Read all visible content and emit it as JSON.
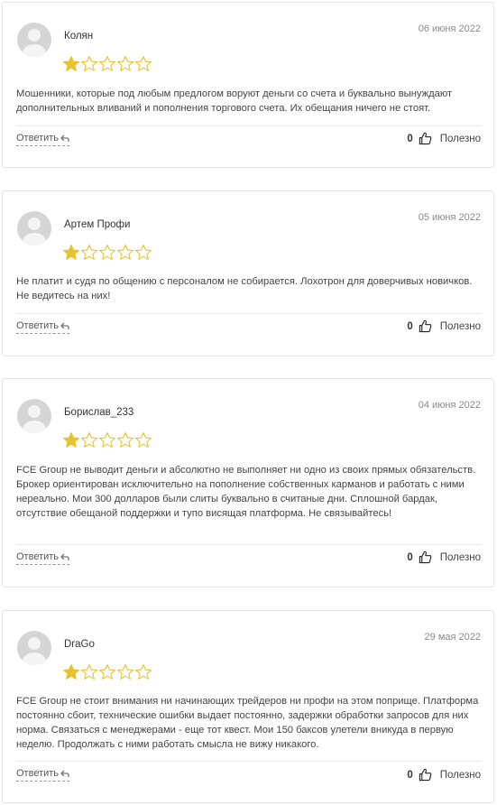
{
  "reviews": [
    {
      "author": "Колян",
      "date": "06 июня 2022",
      "rating": 1,
      "max_rating": 5,
      "text": "Мошенники, которые под любым предлогом воруют деньги со счета и буквально вынуждают дополнительных вливаний и пополнения торгового счета. Их обещания ничего не стоят.",
      "reply_label": "Ответить",
      "likes": "0",
      "useful_label": "Полезно"
    },
    {
      "author": "Артем Профи",
      "date": "05 июня 2022",
      "rating": 1,
      "max_rating": 5,
      "text": "Не платит и судя по общению с персоналом не собирается. Лохотрон для доверчивых новичков. Не ведитесь на них!",
      "reply_label": "Ответить",
      "likes": "0",
      "useful_label": "Полезно"
    },
    {
      "author": "Борислав_233",
      "date": "04 июня 2022",
      "rating": 1,
      "max_rating": 5,
      "text": "FCE Group не выводит деньги и абсолютно не выполняет ни одно из своих прямых обязательств. Брокер ориентирован исключительно на пополнение собственных карманов и работать с ними нереально. Мои 300 долларов были слиты буквально в считаные дни. Сплошной бардак, отсутствие обещаной поддержки и тупо висящая платформа. Не связывайтесь!",
      "reply_label": "Ответить",
      "likes": "0",
      "useful_label": "Полезно"
    },
    {
      "author": "DraGo",
      "date": "29 мая 2022",
      "rating": 1,
      "max_rating": 5,
      "text": "FCE Group не стоит внимания ни начинающих трейдеров ни профи на этом поприще. Платформа постоянно сбоит, технические ошибки выдает постоянно, задержки обработки запросов для них норма. Связаться с менеджерами - еще тот квест. Мои 150 баксов улетели вникуда в первую неделю. Продолжать с ними работать смысла не вижу никакого.",
      "reply_label": "Ответить",
      "likes": "0",
      "useful_label": "Полезно"
    }
  ],
  "colors": {
    "star_filled": "#e8c22c",
    "star_empty_stroke": "#e8c22c",
    "border": "#e3e3e3",
    "date": "#8a8a8a"
  }
}
